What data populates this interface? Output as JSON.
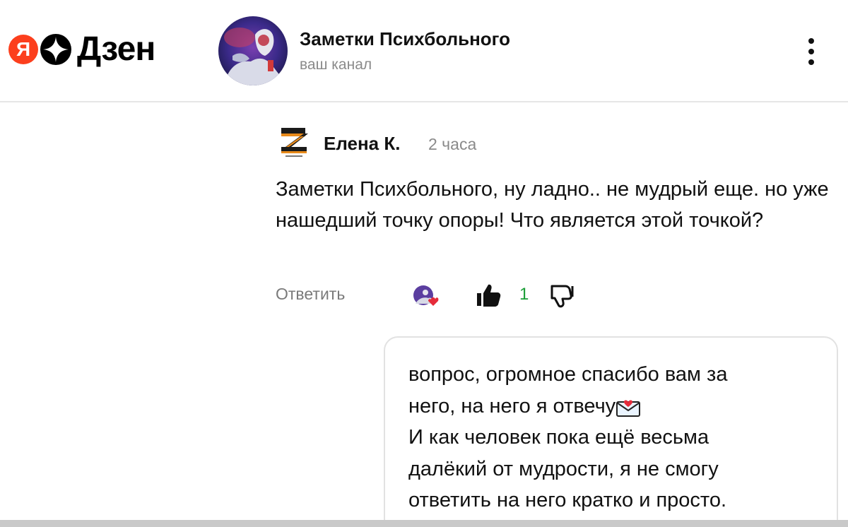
{
  "app": {
    "logo_ya": "Я",
    "logo_name": "Дзен"
  },
  "channel": {
    "title": "Заметки Психбольного",
    "subtitle": "ваш канал"
  },
  "comment": {
    "author": "Елена К.",
    "time": "2 часа",
    "text": "Заметки Психбольного, ну ладно.. не мудрый еще. но уже нашедший точку опоры! Что является этой точкой?",
    "reply_label": "Ответить",
    "likes": "1"
  },
  "reply": {
    "lines": [
      "вопрос, огромное спасибо вам за",
      "него, на него я отвечу",
      "И как человек пока ещё весьма",
      "далёкий от мудрости, я не смогу",
      "ответить на него кратко и просто."
    ]
  },
  "icons": {
    "more": "more-vertical-icon",
    "like": "thumbs-up-icon",
    "dislike": "thumbs-down-icon",
    "mail": "love-letter-icon"
  },
  "colors": {
    "ya_red": "#fc3f1d",
    "like_green": "#1a9d36",
    "muted_text": "#8a8a8a"
  }
}
